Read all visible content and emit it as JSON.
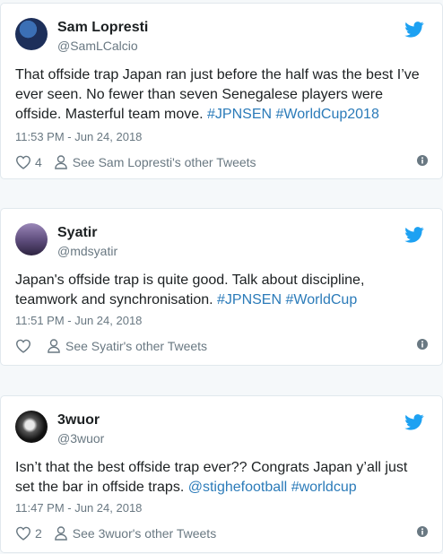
{
  "tweets": [
    {
      "name": "Sam Lopresti",
      "handle": "@SamLCalcio",
      "text_before": "That offside trap Japan ran just before the half was the best I’ve ever seen. No fewer than seven Senegalese players were offside. Masterful team move. ",
      "links": [
        "#JPNSEN",
        "#WorldCup2018"
      ],
      "time": "11:53 PM - Jun 24, 2018",
      "likes": "4",
      "other_tweets": "See Sam Lopresti's other Tweets"
    },
    {
      "name": "Syatir",
      "handle": "@mdsyatir",
      "text_before": "Japan's offside trap is quite good. Talk about discipline, teamwork and synchronisation. ",
      "links": [
        "#JPNSEN",
        "#WorldCup"
      ],
      "time": "11:51 PM - Jun 24, 2018",
      "likes": "",
      "other_tweets": "See Syatir's other Tweets"
    },
    {
      "name": "3wuor",
      "handle": "@3wuor",
      "text_before": "Isn’t that the best offside trap ever?? Congrats Japan y’all just set the bar in offside traps. ",
      "links": [
        "@stighefootball",
        "#worldcup"
      ],
      "time": "11:47 PM - Jun 24, 2018",
      "likes": "2",
      "other_tweets": "See 3wuor's other Tweets"
    }
  ],
  "colors": {
    "link": "#2b7bb9",
    "twitter_blue": "#1da1f2",
    "muted": "#697882"
  },
  "icons": [
    "twitter-bird-icon",
    "heart-icon",
    "person-icon",
    "info-icon"
  ]
}
